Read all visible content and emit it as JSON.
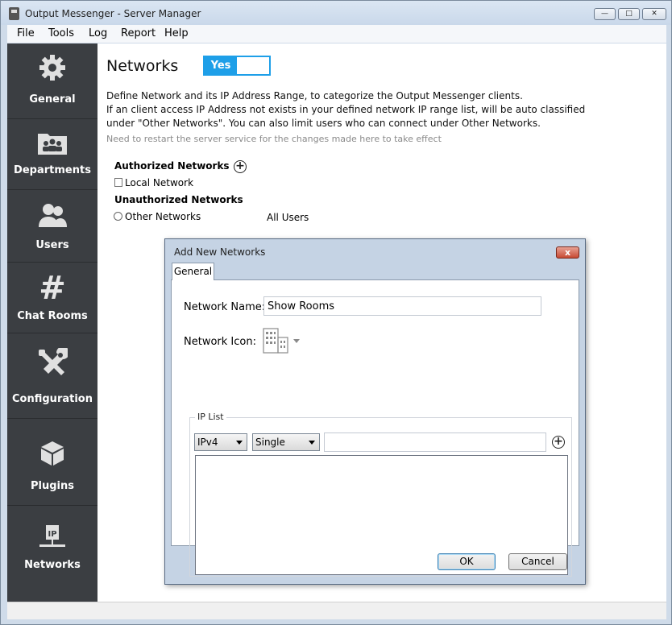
{
  "window": {
    "title": "Output Messenger - Server Manager"
  },
  "menu": [
    "File",
    "Tools",
    "Log",
    "Report",
    "Help"
  ],
  "sidebar": {
    "items": [
      {
        "label": "General",
        "icon": "gear-icon"
      },
      {
        "label": "Departments",
        "icon": "folder-users-icon"
      },
      {
        "label": "Users",
        "icon": "users-icon"
      },
      {
        "label": "Chat Rooms",
        "icon": "hash-icon"
      },
      {
        "label": "Configuration",
        "icon": "tools-icon"
      },
      {
        "label": "Plugins",
        "icon": "blocks-icon"
      },
      {
        "label": "Networks",
        "icon": "ip-network-icon"
      }
    ],
    "active": "Networks",
    "bg_color": "#3b3e42"
  },
  "main": {
    "title": "Networks",
    "toggle_label": "Yes",
    "accent_color": "#1e9fe8",
    "desc_line1": "Define Network and its IP Address Range, to categorize the Output Messenger clients.",
    "desc_line2": "If an client access IP Address not exists in your defined network IP range list, will be auto classified",
    "desc_line3": "under \"Other Networks\". You can also limit users who can connect under Other Networks.",
    "note": "Need to restart the server service for the changes made here to take effect",
    "authorized_heading": "Authorized Networks",
    "local_network": "Local Network",
    "unauthorized_heading": "Unauthorized Networks",
    "other_networks": "Other Networks",
    "other_networks_users": "All Users"
  },
  "dialog": {
    "title": "Add New Networks",
    "close_label": "x",
    "tab": "General",
    "network_name_label": "Network Name:",
    "network_name_value": "Show Rooms",
    "network_icon_label": "Network Icon:",
    "ip_list_legend": "IP List",
    "ip_version": "IPv4",
    "ip_mode": "Single",
    "ip_value": "",
    "ok_label": "OK",
    "cancel_label": "Cancel"
  }
}
